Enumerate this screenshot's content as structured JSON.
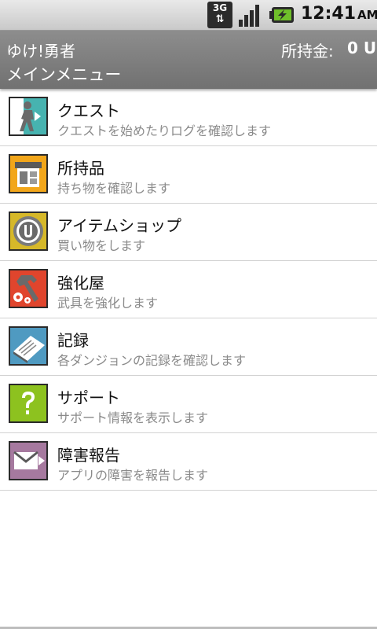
{
  "status_bar": {
    "network": "3G",
    "time": "12:41",
    "ampm": "AM",
    "icons": [
      "network-3g-icon",
      "signal-icon",
      "battery-charging-icon"
    ]
  },
  "header": {
    "app_name": "ゆけ!勇者",
    "money_label": "所持金:",
    "money_value": "0 U",
    "screen_title": "メインメニュー"
  },
  "menu": [
    {
      "title": "クエスト",
      "subtitle": "クエストを始めたりログを確認します",
      "icon": "quest-icon",
      "color": "#47b3b0"
    },
    {
      "title": "所持品",
      "subtitle": "持ち物を確認します",
      "icon": "inventory-icon",
      "color": "#f2a61a"
    },
    {
      "title": "アイテムショップ",
      "subtitle": "買い物をします",
      "icon": "shop-coin-icon",
      "color": "#d6b829"
    },
    {
      "title": "強化屋",
      "subtitle": "武具を強化します",
      "icon": "upgrade-icon",
      "color": "#e0452d"
    },
    {
      "title": "記録",
      "subtitle": "各ダンジョンの記録を確認します",
      "icon": "records-icon",
      "color": "#4f9ac1"
    },
    {
      "title": "サポート",
      "subtitle": "サポート情報を表示します",
      "icon": "help-icon",
      "color": "#8dc21f"
    },
    {
      "title": "障害報告",
      "subtitle": "アプリの障害を報告します",
      "icon": "mail-report-icon",
      "color": "#a6799f"
    }
  ]
}
